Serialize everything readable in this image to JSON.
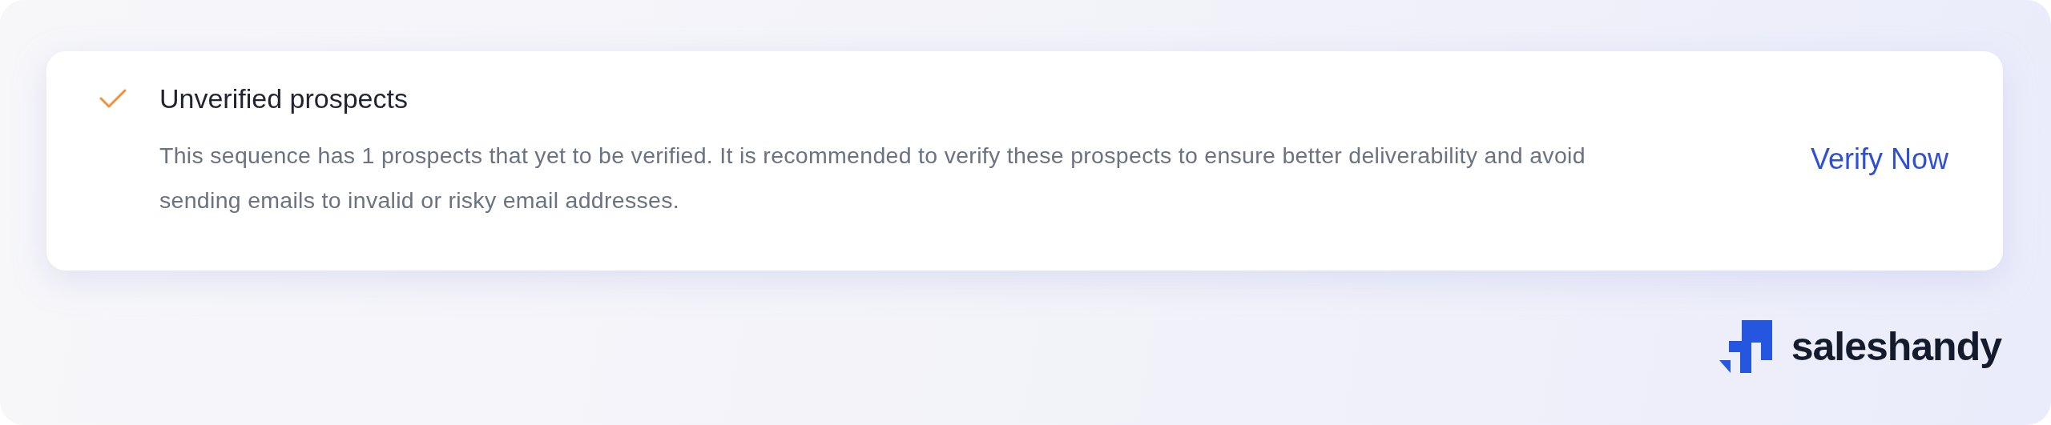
{
  "alert": {
    "title": "Unverified prospects",
    "description": "This sequence has 1 prospects that yet to be verified. It is recommended to verify these prospects to ensure better deliverability and avoid sending emails to invalid or risky email addresses.",
    "action": "Verify Now"
  },
  "brand": {
    "name": "saleshandy"
  }
}
